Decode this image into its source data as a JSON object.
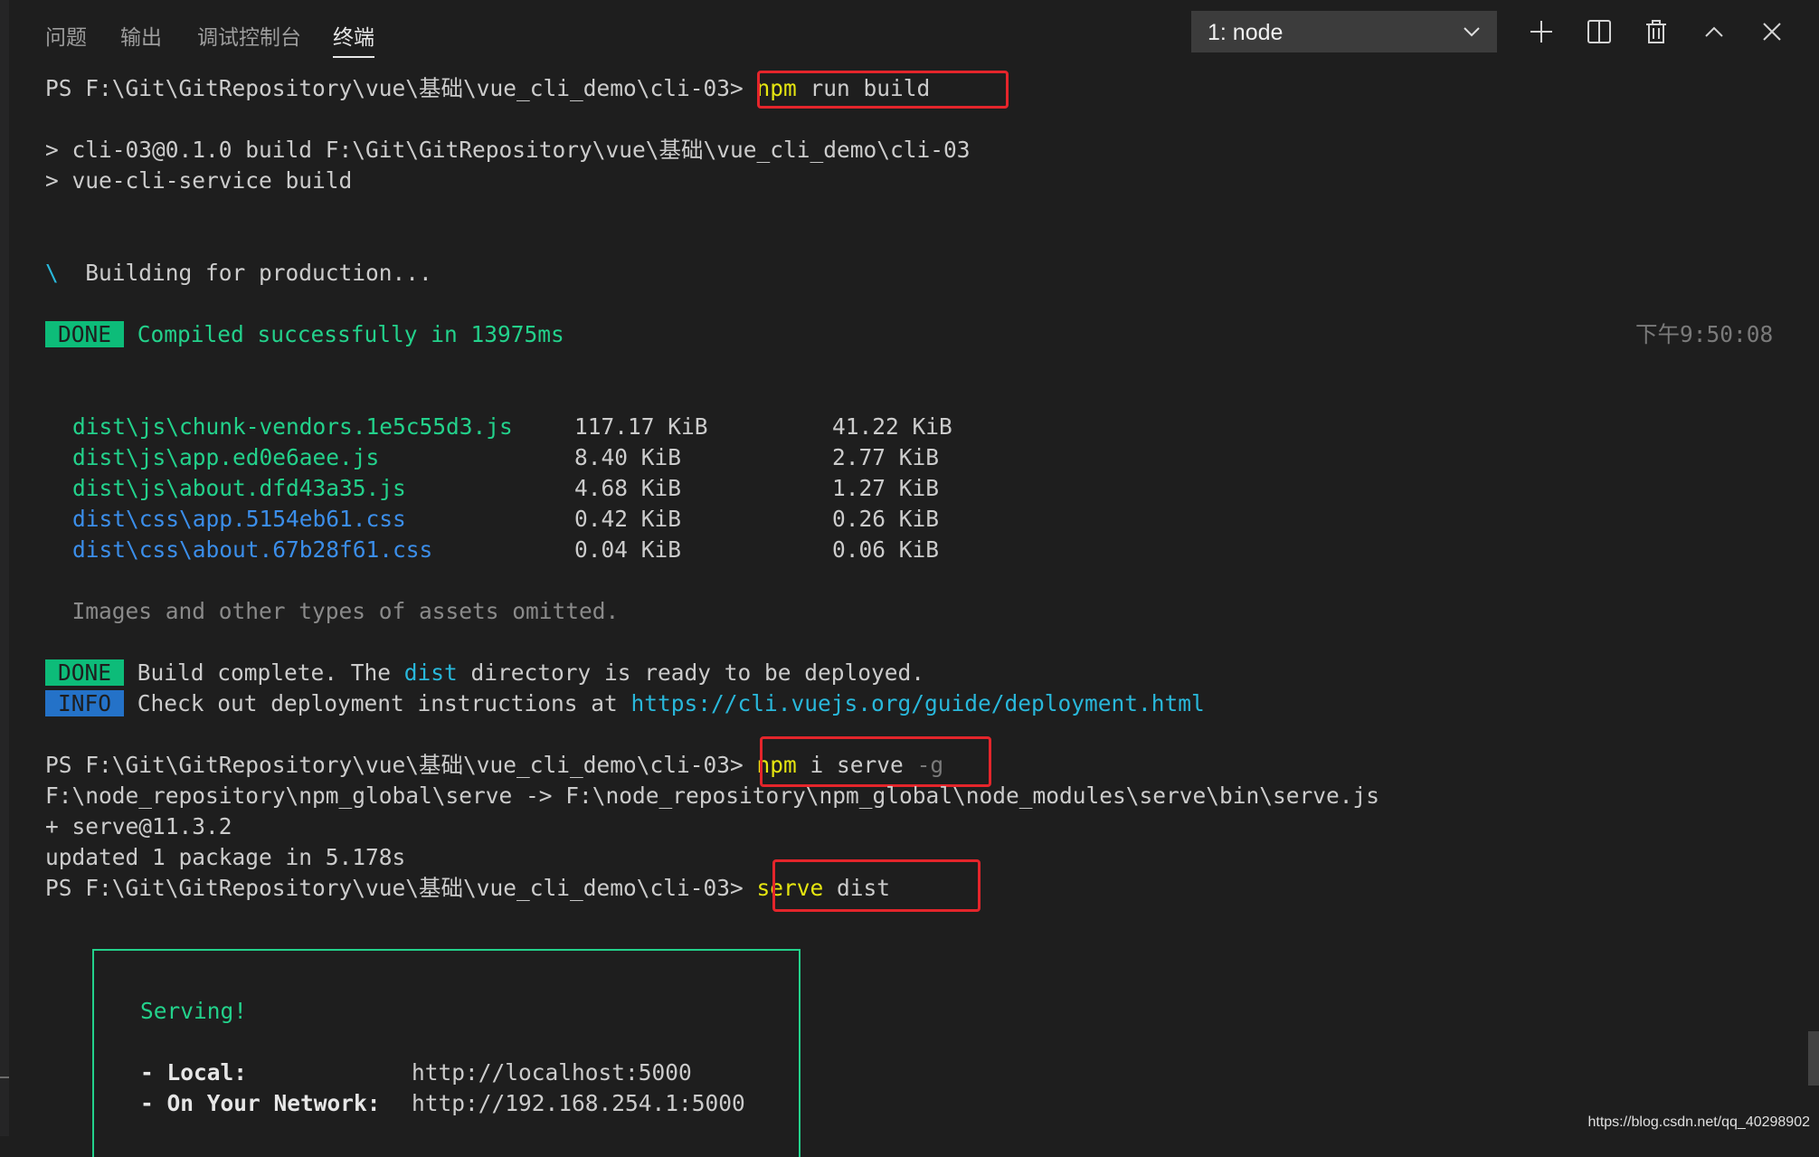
{
  "panel": {
    "tabs": [
      "问题",
      "输出",
      "调试控制台",
      "终端"
    ],
    "active_tab": "终端",
    "terminal_select": "1: node"
  },
  "lines": {
    "ps_prefix": "PS F:\\Git\\GitRepository\\vue\\基础\\vue_cli_demo\\cli-03>",
    "cmd1_npm": "npm",
    "cmd1_rest": " run build",
    "build_line1": "> cli-03@0.1.0 build F:\\Git\\GitRepository\\vue\\基础\\vue_cli_demo\\cli-03",
    "build_line2": "> vue-cli-service build",
    "spinner": "\\",
    "building": "  Building for production...",
    "done_badge": "DONE",
    "compiled": " Compiled successfully in 13975ms",
    "timestamp": "下午9:50:08",
    "omitted": "  Images and other types of assets omitted.",
    "build_complete_pre": " Build complete. The ",
    "build_complete_dist": "dist",
    "build_complete_post": " directory is ready to be deployed.",
    "info_badge": "INFO",
    "info_text": " Check out deployment instructions at ",
    "info_link": "https://cli.vuejs.org/guide/deployment.html",
    "cmd2_npm": "npm",
    "cmd2_rest": " i serve ",
    "cmd2_flag": "-g",
    "serve_path": "F:\\node_repository\\npm_global\\serve -> F:\\node_repository\\npm_global\\node_modules\\serve\\bin\\serve.js",
    "serve_version": "+ serve@11.3.2",
    "updated": "updated 1 package in 5.178s",
    "cmd3_serve": "serve",
    "cmd3_rest": " dist"
  },
  "assets": [
    {
      "file": "dist\\js\\chunk-vendors.1e5c55d3.js",
      "size": "117.17 KiB",
      "gzip": "41.22 KiB",
      "kind": "js"
    },
    {
      "file": "dist\\js\\app.ed0e6aee.js",
      "size": "8.40 KiB",
      "gzip": "2.77 KiB",
      "kind": "js"
    },
    {
      "file": "dist\\js\\about.dfd43a35.js",
      "size": "4.68 KiB",
      "gzip": "1.27 KiB",
      "kind": "js"
    },
    {
      "file": "dist\\css\\app.5154eb61.css",
      "size": "0.42 KiB",
      "gzip": "0.26 KiB",
      "kind": "css"
    },
    {
      "file": "dist\\css\\about.67b28f61.css",
      "size": "0.04 KiB",
      "gzip": "0.06 KiB",
      "kind": "css"
    }
  ],
  "serve_box": {
    "title": "Serving!",
    "local_label": "- Local:",
    "local_url": "http://localhost:5000",
    "network_label": "- On Your Network:",
    "network_url": "http://192.168.254.1:5000"
  },
  "watermark": "https://blog.csdn.net/qq_40298902",
  "colors": {
    "background": "#1e1e1e",
    "highlight_box": "#e4252b",
    "done_badge": "#0dbc79",
    "info_badge": "#2472c8"
  }
}
